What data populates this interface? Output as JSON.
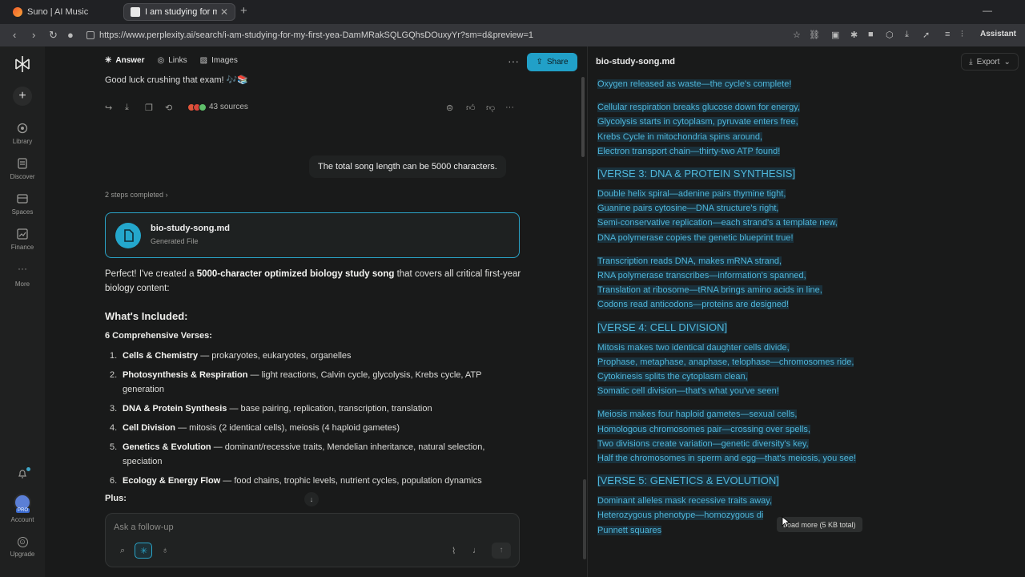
{
  "browser": {
    "tabs": [
      {
        "title": "Suno | AI Music",
        "active": false
      },
      {
        "title": "I am studying for my first yea",
        "active": true
      }
    ],
    "url": "https://www.perplexity.ai/search/i-am-studying-for-my-first-yea-DamMRakSQLGQhsDOuxyYr?sm=d&preview=1",
    "assistant_label": "Assistant"
  },
  "rail": {
    "items": [
      {
        "label": "Library",
        "icon": "library-icon"
      },
      {
        "label": "Discover",
        "icon": "discover-icon"
      },
      {
        "label": "Spaces",
        "icon": "spaces-icon"
      },
      {
        "label": "Finance",
        "icon": "finance-icon"
      },
      {
        "label": "More",
        "icon": "more-icon"
      }
    ],
    "account_label": "Account",
    "pro_badge": "PRO",
    "upgrade_label": "Upgrade"
  },
  "chat": {
    "tabs": [
      {
        "label": "Answer",
        "icon": "answer-icon"
      },
      {
        "label": "Links",
        "icon": "globe-icon"
      },
      {
        "label": "Images",
        "icon": "image-icon"
      }
    ],
    "share_label": "Share",
    "prev_tail": "Good luck crushing that exam! 🎶📚",
    "sources": "43 sources",
    "user_message": "The total song length can be 5000 characters.",
    "steps": "2 steps completed",
    "file": {
      "name": "bio-study-song.md",
      "sub": "Generated File"
    },
    "answer_pre": "Perfect! I've created a ",
    "answer_bold": "5000-character optimized biology study song",
    "answer_post": " that covers all critical first-year biology content:",
    "whats_included": "What's Included:",
    "verses_heading": "6 Comprehensive Verses:",
    "list": [
      {
        "n": "1.",
        "b": "Cells & Chemistry",
        "t": " — prokaryotes, eukaryotes, organelles"
      },
      {
        "n": "2.",
        "b": "Photosynthesis & Respiration",
        "t": " — light reactions, Calvin cycle, glycolysis, Krebs cycle, ATP generation"
      },
      {
        "n": "3.",
        "b": "DNA & Protein Synthesis",
        "t": " — base pairing, replication, transcription, translation"
      },
      {
        "n": "4.",
        "b": "Cell Division",
        "t": " — mitosis (2 identical cells), meiosis (4 haploid gametes)"
      },
      {
        "n": "5.",
        "b": "Genetics & Evolution",
        "t": " — dominant/recessive traits, Mendelian inheritance, natural selection, speciation"
      },
      {
        "n": "6.",
        "b": "Ecology & Energy Flow",
        "t": " — food chains, trophic levels, nutrient cycles, population dynamics"
      }
    ],
    "plus": "Plus:",
    "followup_placeholder": "Ask a follow-up"
  },
  "doc": {
    "title": "bio-study-song.md",
    "export_label": "Export",
    "lines": [
      {
        "type": "line",
        "text": "Oxygen released as waste—the cycle's complete!"
      },
      {
        "type": "gap"
      },
      {
        "type": "line",
        "text": "Cellular respiration breaks glucose down for energy,"
      },
      {
        "type": "line",
        "text": "Glycolysis starts in cytoplasm, pyruvate enters free,"
      },
      {
        "type": "line",
        "text": "Krebs Cycle in mitochondria spins around,"
      },
      {
        "type": "line",
        "text": "Electron transport chain—thirty-two ATP found!"
      },
      {
        "type": "section",
        "text": "[VERSE 3: DNA & PROTEIN SYNTHESIS]"
      },
      {
        "type": "line",
        "text": "Double helix spiral—adenine pairs thymine tight,"
      },
      {
        "type": "line",
        "text": "Guanine pairs cytosine—DNA structure's right,"
      },
      {
        "type": "line",
        "text": "Semi-conservative replication—each strand's a template new,"
      },
      {
        "type": "line",
        "text": "DNA polymerase copies the genetic blueprint true!"
      },
      {
        "type": "gap"
      },
      {
        "type": "line",
        "text": "Transcription reads DNA, makes mRNA strand,"
      },
      {
        "type": "line",
        "text": "RNA polymerase transcribes—information's spanned,"
      },
      {
        "type": "line",
        "text": "Translation at ribosome—tRNA brings amino acids in line,"
      },
      {
        "type": "line",
        "text": "Codons read anticodons—proteins are designed!"
      },
      {
        "type": "section",
        "text": "[VERSE 4: CELL DIVISION]"
      },
      {
        "type": "line",
        "text": "Mitosis makes two identical daughter cells divide,"
      },
      {
        "type": "line",
        "text": "Prophase, metaphase, anaphase, telophase—chromosomes ride,"
      },
      {
        "type": "line",
        "text": "Cytokinesis splits the cytoplasm clean,"
      },
      {
        "type": "line",
        "text": "Somatic cell division—that's what you've seen!"
      },
      {
        "type": "gap"
      },
      {
        "type": "line",
        "text": "Meiosis makes four haploid gametes—sexual cells,"
      },
      {
        "type": "line",
        "text": "Homologous chromosomes pair—crossing over spells,"
      },
      {
        "type": "line",
        "text": "Two divisions create variation—genetic diversity's key,"
      },
      {
        "type": "line",
        "text": "Half the chromosomes in sperm and egg—that's meiosis, you see!"
      },
      {
        "type": "section",
        "text": "[VERSE 5: GENETICS & EVOLUTION]"
      },
      {
        "type": "line",
        "text": "Dominant alleles mask recessive traits away,"
      },
      {
        "type": "line",
        "text": "Heterozygous phenotype—homozygous di"
      },
      {
        "type": "line",
        "text": "Punnett squares"
      }
    ],
    "load_more": "Load more (5 KB total)"
  }
}
